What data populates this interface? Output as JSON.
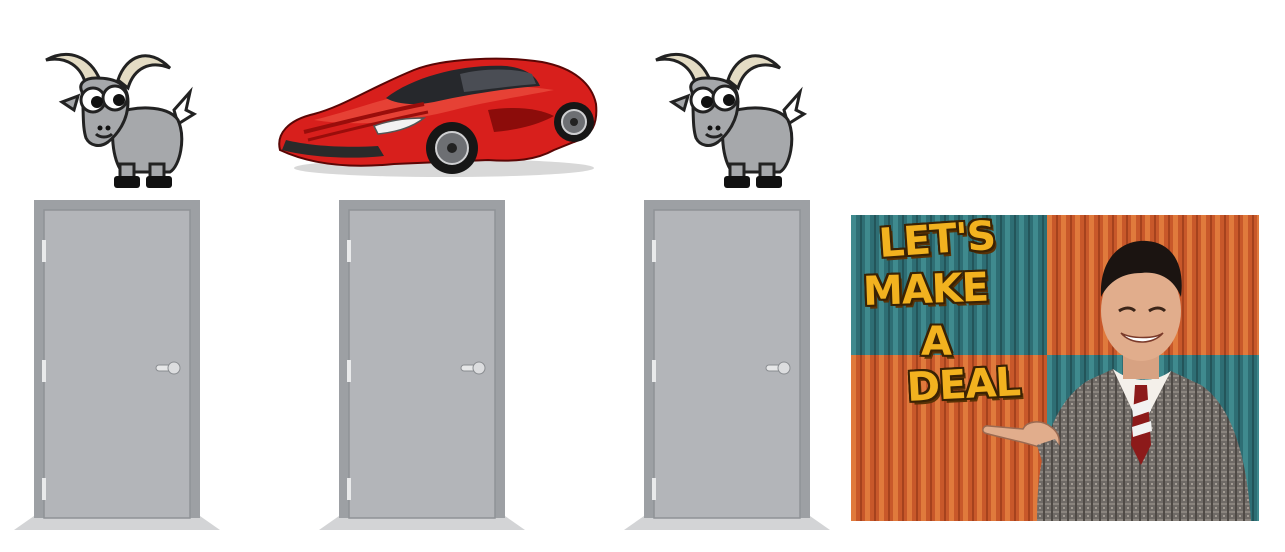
{
  "show_title_lines": [
    "LET'S",
    "MAKE",
    "A",
    "DEAL"
  ],
  "doors": [
    {
      "prize": "goat"
    },
    {
      "prize": "car"
    },
    {
      "prize": "goat"
    }
  ],
  "colors": {
    "door": "#b3b5b9",
    "door_frame": "#9da0a4",
    "goat_body": "#a6a8ab",
    "car": "#d81f1c",
    "title_text": "#f2b21f"
  }
}
